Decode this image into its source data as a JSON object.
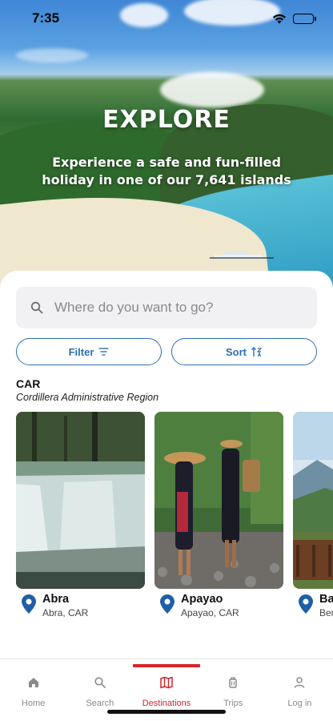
{
  "status_bar": {
    "time": "7:35"
  },
  "hero": {
    "title": "EXPLORE",
    "subtitle": "Experience a safe and fun-filled holiday in one of our 7,641 islands"
  },
  "search": {
    "placeholder": "Where do you want to go?",
    "value": ""
  },
  "filters": {
    "filter_label": "Filter",
    "sort_label": "Sort"
  },
  "region": {
    "code": "CAR",
    "name": "Cordillera Administrative Region"
  },
  "destinations": [
    {
      "title": "Abra",
      "subtitle": "Abra, CAR"
    },
    {
      "title": "Apayao",
      "subtitle": "Apayao, CAR"
    },
    {
      "title": "Ba",
      "subtitle": "Ben"
    }
  ],
  "bottom_nav": {
    "items": [
      {
        "label": "Home",
        "icon": "home-icon"
      },
      {
        "label": "Search",
        "icon": "search-icon"
      },
      {
        "label": "Destinations",
        "icon": "map-icon",
        "active": true
      },
      {
        "label": "Trips",
        "icon": "luggage-icon"
      },
      {
        "label": "Log in",
        "icon": "person-icon"
      }
    ]
  },
  "colors": {
    "accent_blue": "#2d6fb5",
    "active_red": "#d4252a",
    "pin_blue": "#1f5fa8"
  }
}
